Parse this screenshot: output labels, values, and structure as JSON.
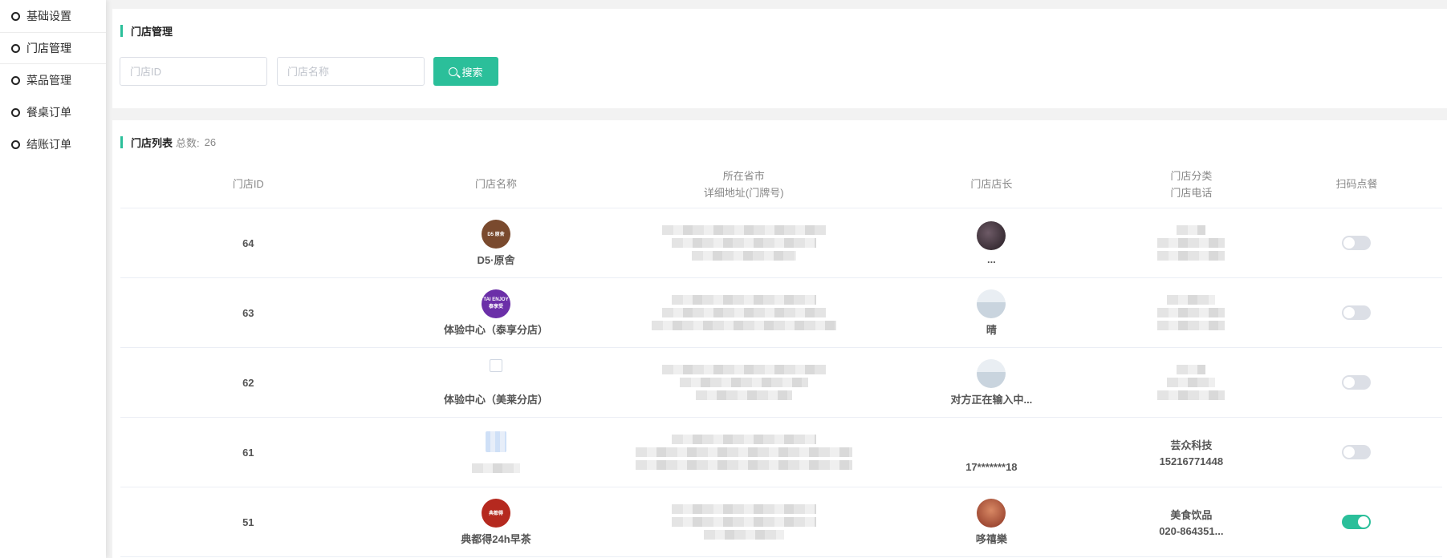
{
  "sidebar": {
    "items": [
      {
        "label": "基础设置"
      },
      {
        "label": "门店管理"
      },
      {
        "label": "菜品管理"
      },
      {
        "label": "餐桌订单"
      },
      {
        "label": "结账订单"
      }
    ]
  },
  "filter": {
    "title": "门店管理",
    "store_id_placeholder": "门店ID",
    "store_name_placeholder": "门店名称",
    "search_label": "搜索"
  },
  "list": {
    "title": "门店列表",
    "count_label": "总数:",
    "count_value": "26",
    "headers": {
      "id": "门店ID",
      "name": "门店名称",
      "region": "所在省市",
      "address": "详细地址(门牌号)",
      "manager": "门店店长",
      "category": "门店分类",
      "phone": "门店电话",
      "qr_order": "扫码点餐"
    },
    "rows": [
      {
        "id": "64",
        "name": "D5·原舍",
        "avatar": "D5 原舍",
        "manager": "...",
        "category": "",
        "phone": "",
        "qr_on": false
      },
      {
        "id": "63",
        "name": "体验中心（泰享分店）",
        "avatar": "TAI ENJOY 泰享受",
        "manager": "晴",
        "category": "",
        "phone": "",
        "qr_on": false
      },
      {
        "id": "62",
        "name": "体验中心（美莱分店）",
        "avatar": "",
        "manager": "对方正在输入中...",
        "category": "",
        "phone": "",
        "qr_on": false
      },
      {
        "id": "61",
        "name": "",
        "avatar": "",
        "manager": "17*******18",
        "category": "芸众科技",
        "phone": "15216771448",
        "qr_on": false
      },
      {
        "id": "51",
        "name": "典都得24h早茶",
        "avatar": "典都得",
        "manager": "哆禧樂",
        "category": "美食饮品",
        "phone": "020-864351...",
        "qr_on": true
      }
    ]
  }
}
